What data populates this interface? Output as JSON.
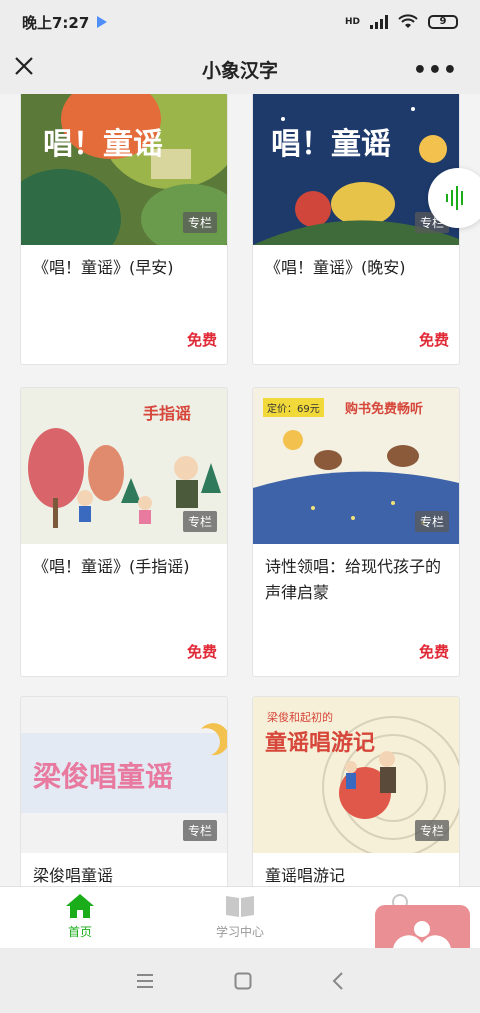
{
  "status_bar": {
    "time": "晚上7:27",
    "network": "HD",
    "battery": "9"
  },
  "nav": {
    "title": "小象汉字",
    "more": "•••"
  },
  "cards": [
    {
      "title": "《唱！童谣》(早安)",
      "badge": "专栏",
      "price": "免费",
      "cover_text": "唱！童谣"
    },
    {
      "title": "《唱！童谣》(晚安)",
      "badge": "专栏",
      "price": "免费",
      "cover_text": "唱！童谣"
    },
    {
      "title": "《唱！童谣》(手指谣)",
      "badge": "专栏",
      "price": "免费",
      "cover_text": "手指谣"
    },
    {
      "title": "诗性领唱：给现代孩子的声律启蒙",
      "badge": "专栏",
      "price": "免费",
      "cover_text": "购书免费畅听",
      "cover_price": "定价：69元"
    },
    {
      "title": "梁俊唱童谣",
      "badge": "专栏",
      "cover_text": "梁俊唱童谣"
    },
    {
      "title": "童谣唱游记",
      "badge": "专栏",
      "cover_text": "童谣唱游记",
      "cover_subtext": "梁俊和起初的"
    }
  ],
  "tabbar": {
    "items": [
      {
        "label": "首页",
        "active": true
      },
      {
        "label": "学习中心",
        "active": false
      },
      {
        "label": "",
        "active": false
      }
    ]
  },
  "colors": {
    "accent_green": "#1aad19",
    "price_red": "#e02a38",
    "widget_pink": "#ea8f93"
  }
}
